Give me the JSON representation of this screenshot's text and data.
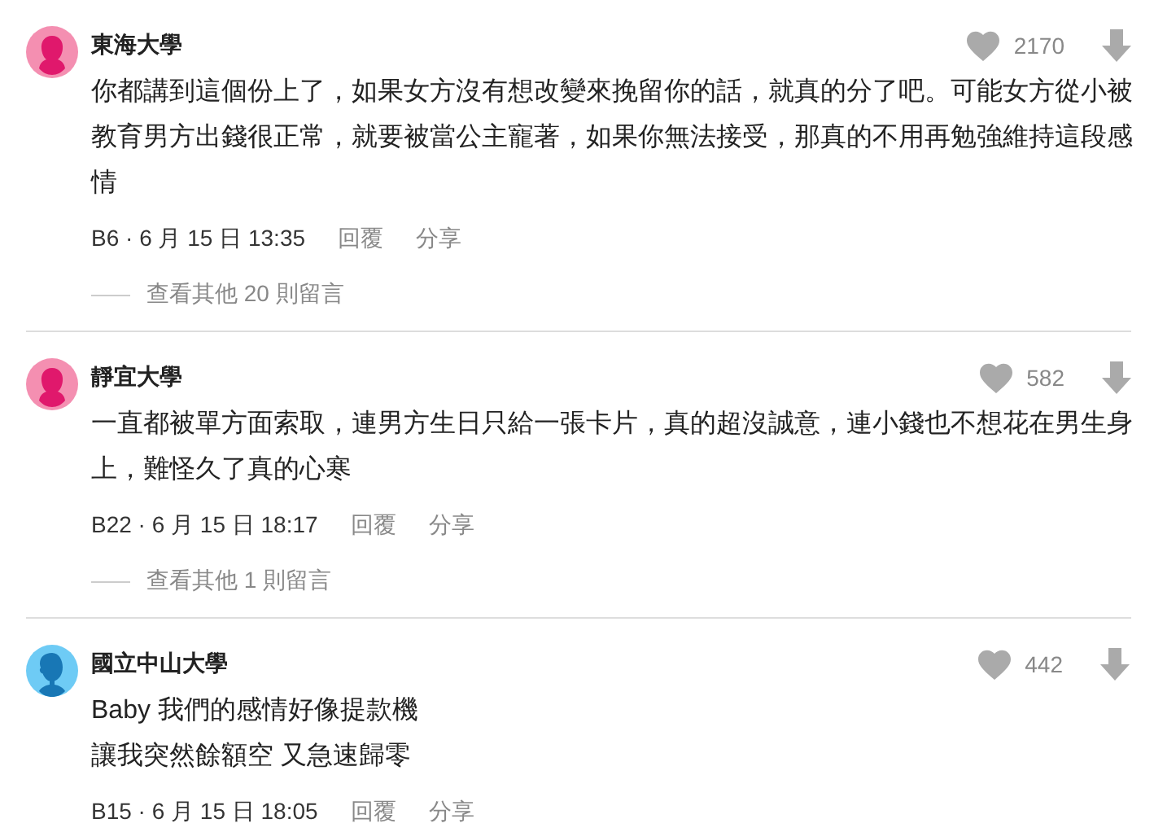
{
  "comments": [
    {
      "kind": "female",
      "school": "東海大學",
      "likes": "2170",
      "lines": [
        "你都講到這個份上了，如果女方沒有想改變來挽留你的話，就真的分了吧。可能女方從小被",
        "教育男方出錢很正常，就要被當公主寵著，如果你無法接受，那真的不用再勉強維持這段感",
        "情"
      ],
      "meta": "B6 · 6 月 15 日 13:35",
      "reply": "回覆",
      "share": "分享",
      "more_replies": "查看其他 20 則留言"
    },
    {
      "kind": "female",
      "school": "靜宜大學",
      "likes": "582",
      "lines": [
        "一直都被單方面索取，連男方生日只給一張卡片，真的超沒誠意，連小錢也不想花在男生身",
        "上，難怪久了真的心寒"
      ],
      "meta": "B22 · 6 月 15 日 18:17",
      "reply": "回覆",
      "share": "分享",
      "more_replies": "查看其他 1 則留言"
    },
    {
      "kind": "male",
      "school": "國立中山大學",
      "likes": "442",
      "lines": [
        "Baby 我們的感情好像提款機",
        "讓我突然餘額空 又急速歸零"
      ],
      "meta": "B15 · 6 月 15 日 18:05",
      "reply": "回覆",
      "share": "分享"
    }
  ]
}
